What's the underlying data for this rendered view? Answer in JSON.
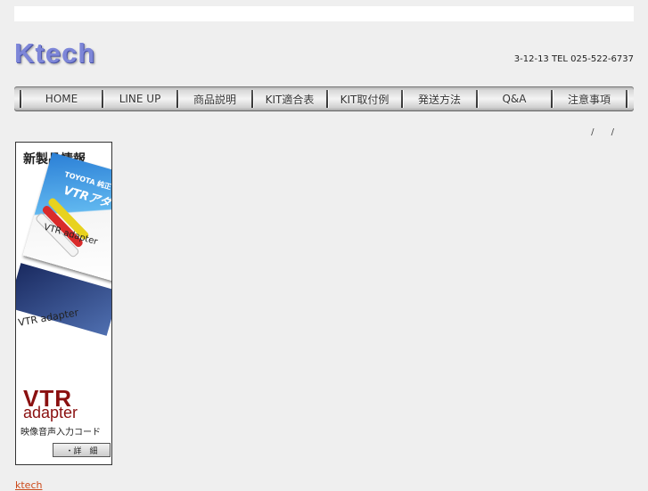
{
  "header": {
    "logo_text": "Ktech",
    "address": "3-12-13 TEL 025-522-6737"
  },
  "nav": {
    "items": [
      {
        "label": "HOME"
      },
      {
        "label": "LINE UP"
      },
      {
        "label": "商品説明"
      },
      {
        "label": "KIT適合表"
      },
      {
        "label": "KIT取付例"
      },
      {
        "label": "発送方法"
      },
      {
        "label": "Q&A"
      },
      {
        "label": "注意事項"
      }
    ]
  },
  "breadcrumb": "/ /",
  "banner": {
    "title": "新製品情報",
    "card_brand": "TOYOTA 純正",
    "card_product": "VTRアダ",
    "card_label": "VTR adapter",
    "photo_label": "VTR adapter",
    "vtr_big": "VTR",
    "vtr_sub": "adapter",
    "description": "映像音声入力コード",
    "detail_button": "・詳　細"
  },
  "footer": {
    "link": "ktech"
  }
}
